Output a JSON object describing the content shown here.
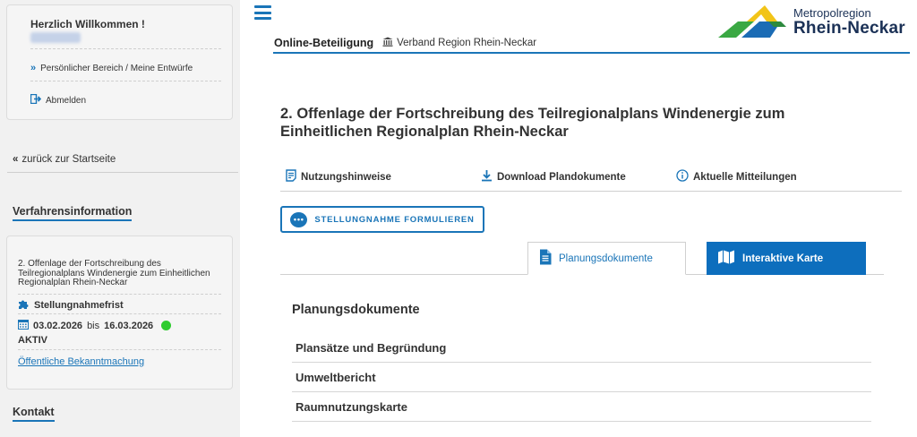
{
  "sidebar": {
    "welcome": "Herzlich Willkommen !",
    "personal_link": "Persönlicher Bereich / Meine Entwürfe",
    "logout": "Abmelden",
    "back_link": "zurück zur Startseite",
    "verfahren_title": "Verfahrensinformation",
    "info": {
      "description": "2. Offenlage der Fortschreibung des Teilregionalplans Windenergie zum Einheitlichen Regionalplan Rhein-Neckar",
      "frist_label": "Stellungnahmefrist",
      "date_from": "03.02.2026",
      "date_sep": "bis",
      "date_to": "16.03.2026",
      "status": "AKTIV",
      "bekanntmachung": "Öffentliche Bekanntmachung"
    },
    "kontakt_title": "Kontakt"
  },
  "header": {
    "breadcrumb_main": "Online-Beteiligung",
    "breadcrumb_org": "Verband Region Rhein-Neckar",
    "logo_line1": "Metropolregion",
    "logo_line2": "Rhein-Neckar"
  },
  "main": {
    "title": "2. Offenlage der Fortschreibung des Teilregionalplans Windenergie zum Einheitlichen Regionalplan Rhein-Neckar",
    "nav": {
      "hinweise": "Nutzungshinweise",
      "download": "Download Plandokumente",
      "mitteilungen": "Aktuelle Mitteilungen"
    },
    "stellungnahme_button": "STELLUNGNAHME FORMULIEREN",
    "tabs": {
      "planung": "Planungsdokumente",
      "karte": "Interaktive Karte"
    },
    "docs_title": "Planungsdokumente",
    "documents": [
      "Plansätze und Begründung",
      "Umweltbericht",
      "Raumnutzungskarte"
    ]
  },
  "colors": {
    "accent": "#1a75b8",
    "tab_active_bg": "#0d6ebd",
    "status_green": "#2ecc2e",
    "logo_yellow": "#f2c418",
    "logo_green": "#3aa843",
    "logo_blue": "#1b6cb5"
  }
}
